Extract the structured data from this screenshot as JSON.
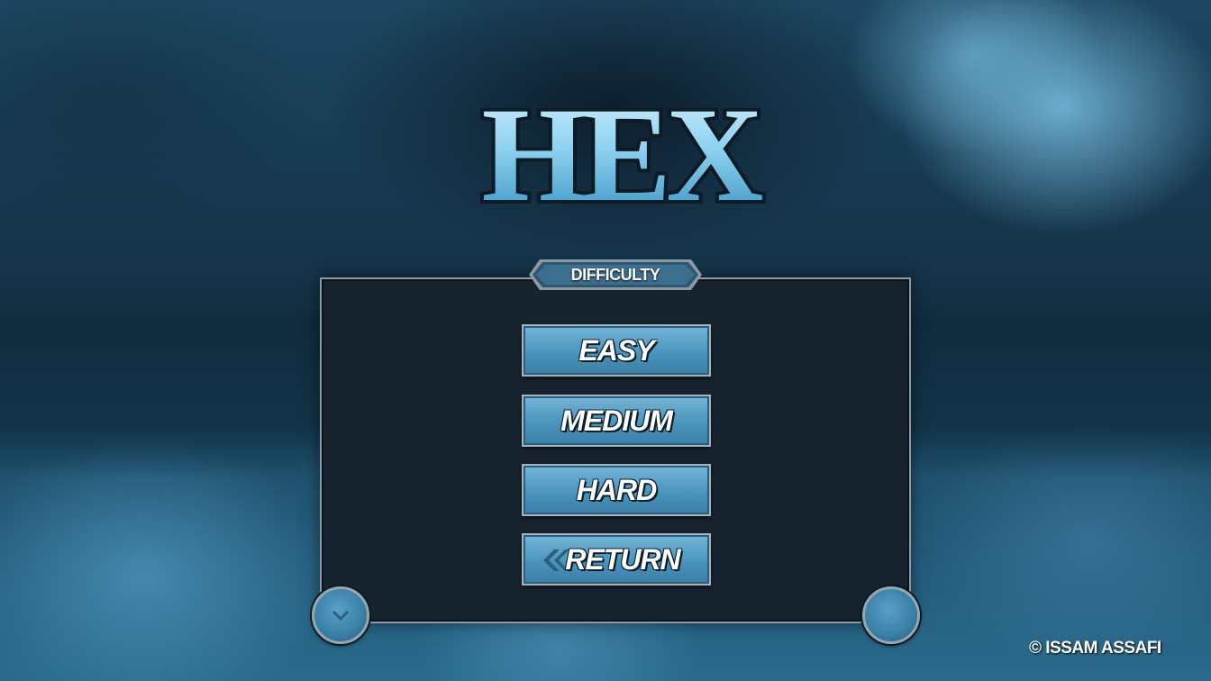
{
  "game": {
    "logo_text": "HEX"
  },
  "panel": {
    "title": "DIFFICULTY"
  },
  "menu": {
    "easy_label": "EASY",
    "medium_label": "MEDIUM",
    "hard_label": "HARD",
    "return_label": "RETURN",
    "return_icon": "chevron-left-icon"
  },
  "footer": {
    "copyright": "© ISSAM ASSAFI"
  },
  "colors": {
    "button_fill": "#4a94bd",
    "panel_fill": "#17232e",
    "panel_border": "#8b9aa6",
    "background": "#183a52"
  }
}
